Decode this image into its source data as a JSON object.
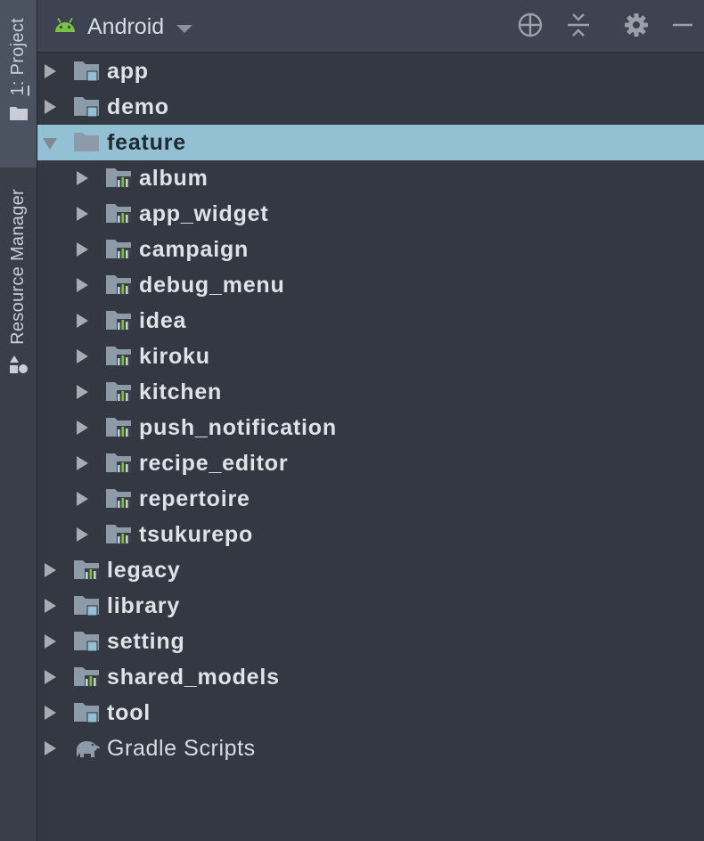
{
  "toolwindow": {
    "strip_tabs": [
      {
        "label_prefix": "1",
        "label_rest": ": Project",
        "icon": "folder-icon",
        "active": true
      },
      {
        "label": "Resource Manager",
        "icon": "resource-manager-icon",
        "active": false
      }
    ],
    "view_selector": {
      "label": "Android",
      "icon": "android-icon"
    },
    "header_actions": [
      "locate-target-icon",
      "collapse-all-icon",
      "gear-icon",
      "minimize-icon"
    ]
  },
  "tree": [
    {
      "label": "app",
      "depth": 0,
      "expanded": false,
      "icon": "module-folder-icon"
    },
    {
      "label": "demo",
      "depth": 0,
      "expanded": false,
      "icon": "module-folder-icon"
    },
    {
      "label": "feature",
      "depth": 0,
      "expanded": true,
      "selected": true,
      "icon": "folder-icon"
    },
    {
      "label": "album",
      "depth": 1,
      "expanded": false,
      "icon": "android-module-icon"
    },
    {
      "label": "app_widget",
      "depth": 1,
      "expanded": false,
      "icon": "android-module-icon"
    },
    {
      "label": "campaign",
      "depth": 1,
      "expanded": false,
      "icon": "android-module-icon"
    },
    {
      "label": "debug_menu",
      "depth": 1,
      "expanded": false,
      "icon": "android-module-icon"
    },
    {
      "label": "idea",
      "depth": 1,
      "expanded": false,
      "icon": "android-module-icon"
    },
    {
      "label": "kiroku",
      "depth": 1,
      "expanded": false,
      "icon": "android-module-icon"
    },
    {
      "label": "kitchen",
      "depth": 1,
      "expanded": false,
      "icon": "android-module-icon"
    },
    {
      "label": "push_notification",
      "depth": 1,
      "expanded": false,
      "icon": "android-module-icon"
    },
    {
      "label": "recipe_editor",
      "depth": 1,
      "expanded": false,
      "icon": "android-module-icon"
    },
    {
      "label": "repertoire",
      "depth": 1,
      "expanded": false,
      "icon": "android-module-icon"
    },
    {
      "label": "tsukurepo",
      "depth": 1,
      "expanded": false,
      "icon": "android-module-icon"
    },
    {
      "label": "legacy",
      "depth": 0,
      "expanded": false,
      "icon": "android-module-icon"
    },
    {
      "label": "library",
      "depth": 0,
      "expanded": false,
      "icon": "module-folder-icon"
    },
    {
      "label": "setting",
      "depth": 0,
      "expanded": false,
      "icon": "module-folder-icon"
    },
    {
      "label": "shared_models",
      "depth": 0,
      "expanded": false,
      "icon": "android-module-icon"
    },
    {
      "label": "tool",
      "depth": 0,
      "expanded": false,
      "icon": "module-folder-icon"
    },
    {
      "label": "Gradle Scripts",
      "depth": 0,
      "expanded": false,
      "icon": "gradle-elephant-icon",
      "plain": true
    }
  ],
  "colors": {
    "background": "#343843",
    "header": "#3d4350",
    "selection": "#93c0d2",
    "android_green": "#7ac144",
    "module_badge": "#93c0d2"
  }
}
